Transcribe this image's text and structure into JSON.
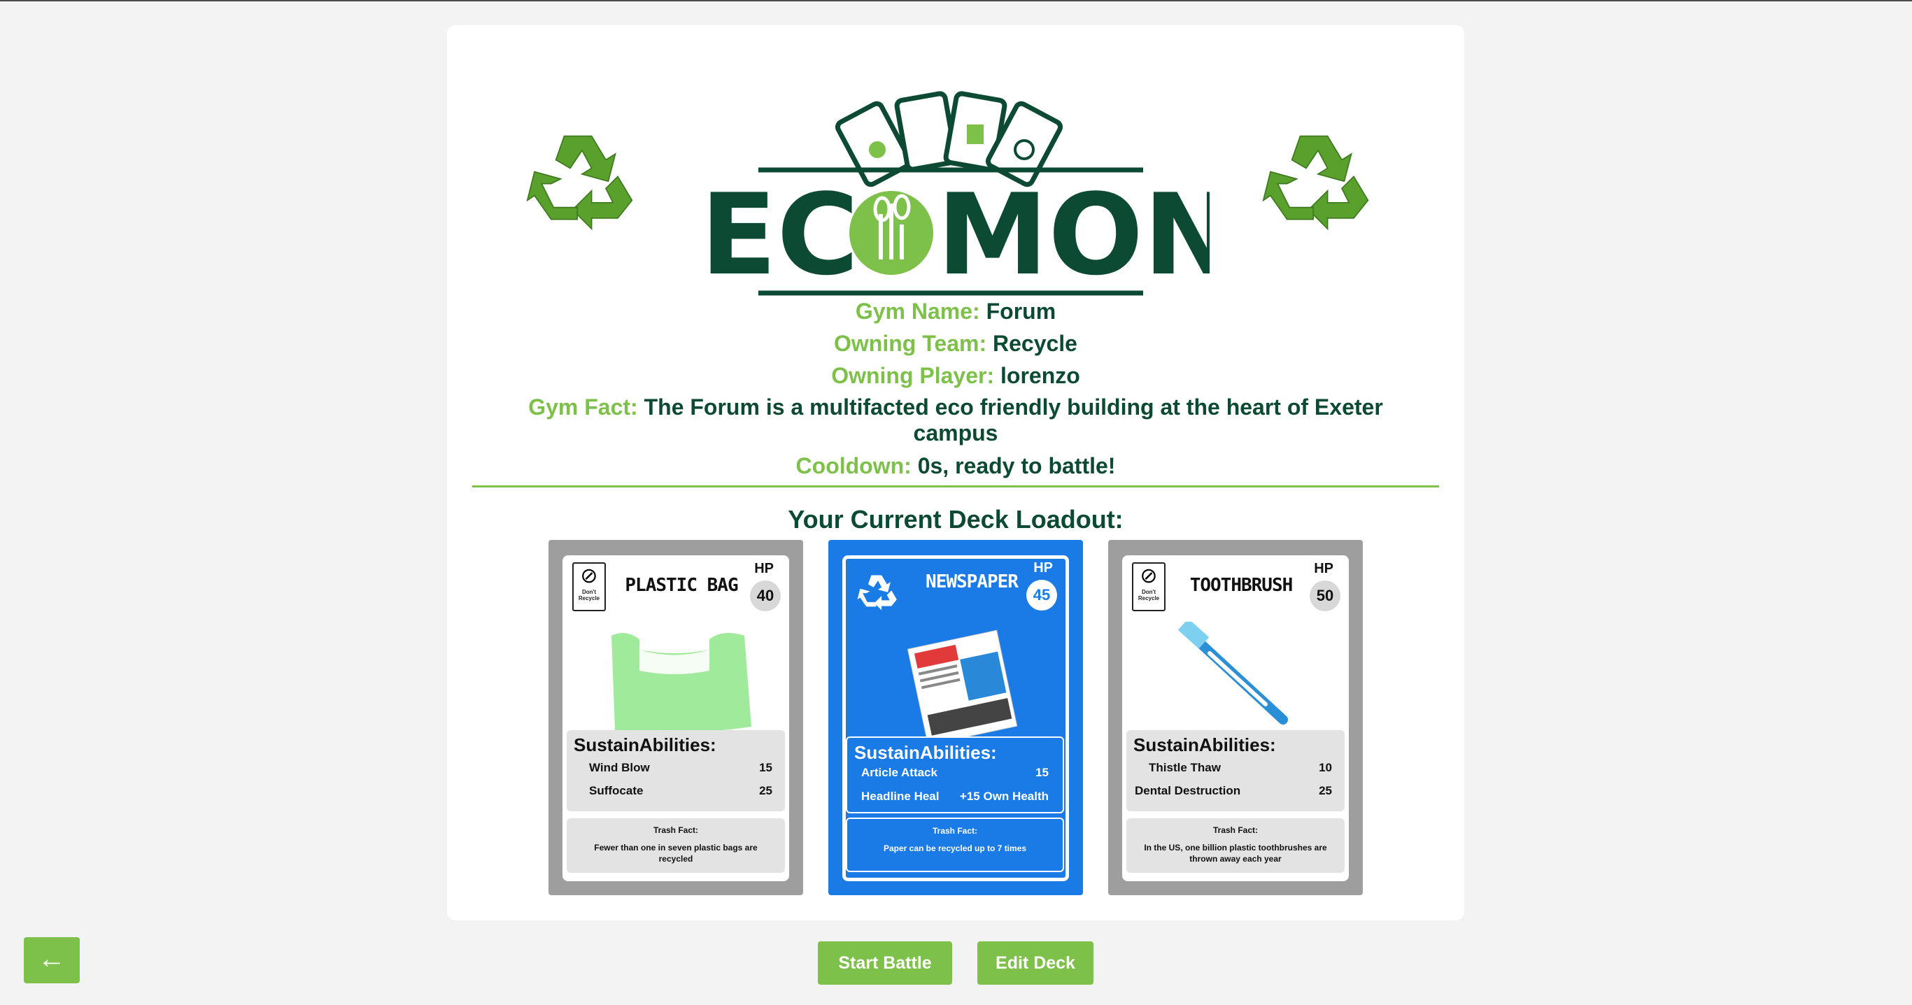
{
  "logo": {
    "text_left": "EC",
    "text_right": "MON"
  },
  "gym": {
    "name_key": "Gym Name:",
    "name_val": "Forum",
    "team_key": "Owning Team:",
    "team_val": "Recycle",
    "player_key": "Owning Player:",
    "player_val": "lorenzo",
    "fact_key": "Gym Fact:",
    "fact_val": "The Forum is a multifacted eco friendly building at the heart of Exeter campus",
    "cooldown_key": "Cooldown:",
    "cooldown_val": "0s, ready to battle!"
  },
  "deck_title": "Your Current Deck Loadout:",
  "cards": [
    {
      "name": "PLASTIC BAG",
      "hp_label": "HP",
      "hp": "40",
      "badge_text": "Don't Recycle",
      "abilities_title": "SustainAbilities:",
      "abilities": [
        {
          "name": "Wind Blow",
          "value": "15"
        },
        {
          "name": "Suffocate",
          "value": "25"
        }
      ],
      "fact_title": "Trash Fact:",
      "fact": "Fewer than one in seven plastic bags are recycled",
      "color": "#9e9e9e"
    },
    {
      "name": "NEWSPAPER",
      "hp_label": "HP",
      "hp": "45",
      "abilities_title": "SustainAbilities:",
      "abilities": [
        {
          "name": "Article Attack",
          "value": "15"
        },
        {
          "name": "Headline Heal",
          "value": "+15 Own Health"
        }
      ],
      "fact_title": "Trash Fact:",
      "fact": "Paper can be recycled up to 7 times",
      "color": "#1a7ae6"
    },
    {
      "name": "TOOTHBRUSH",
      "hp_label": "HP",
      "hp": "50",
      "badge_text": "Don't Recycle",
      "abilities_title": "SustainAbilities:",
      "abilities": [
        {
          "name": "Thistle Thaw",
          "value": "10"
        },
        {
          "name": "Dental Destruction",
          "value": "25"
        }
      ],
      "fact_title": "Trash Fact:",
      "fact": "In the US, one billion plastic toothbrushes are thrown away each year",
      "color": "#9e9e9e"
    }
  ],
  "buttons": {
    "back": "←",
    "start": "Start Battle",
    "edit": "Edit Deck"
  },
  "colors": {
    "accent": "#7dc04a",
    "dark_green": "#0d4a33",
    "blue_card": "#1a7ae6",
    "grey_card": "#9e9e9e"
  }
}
